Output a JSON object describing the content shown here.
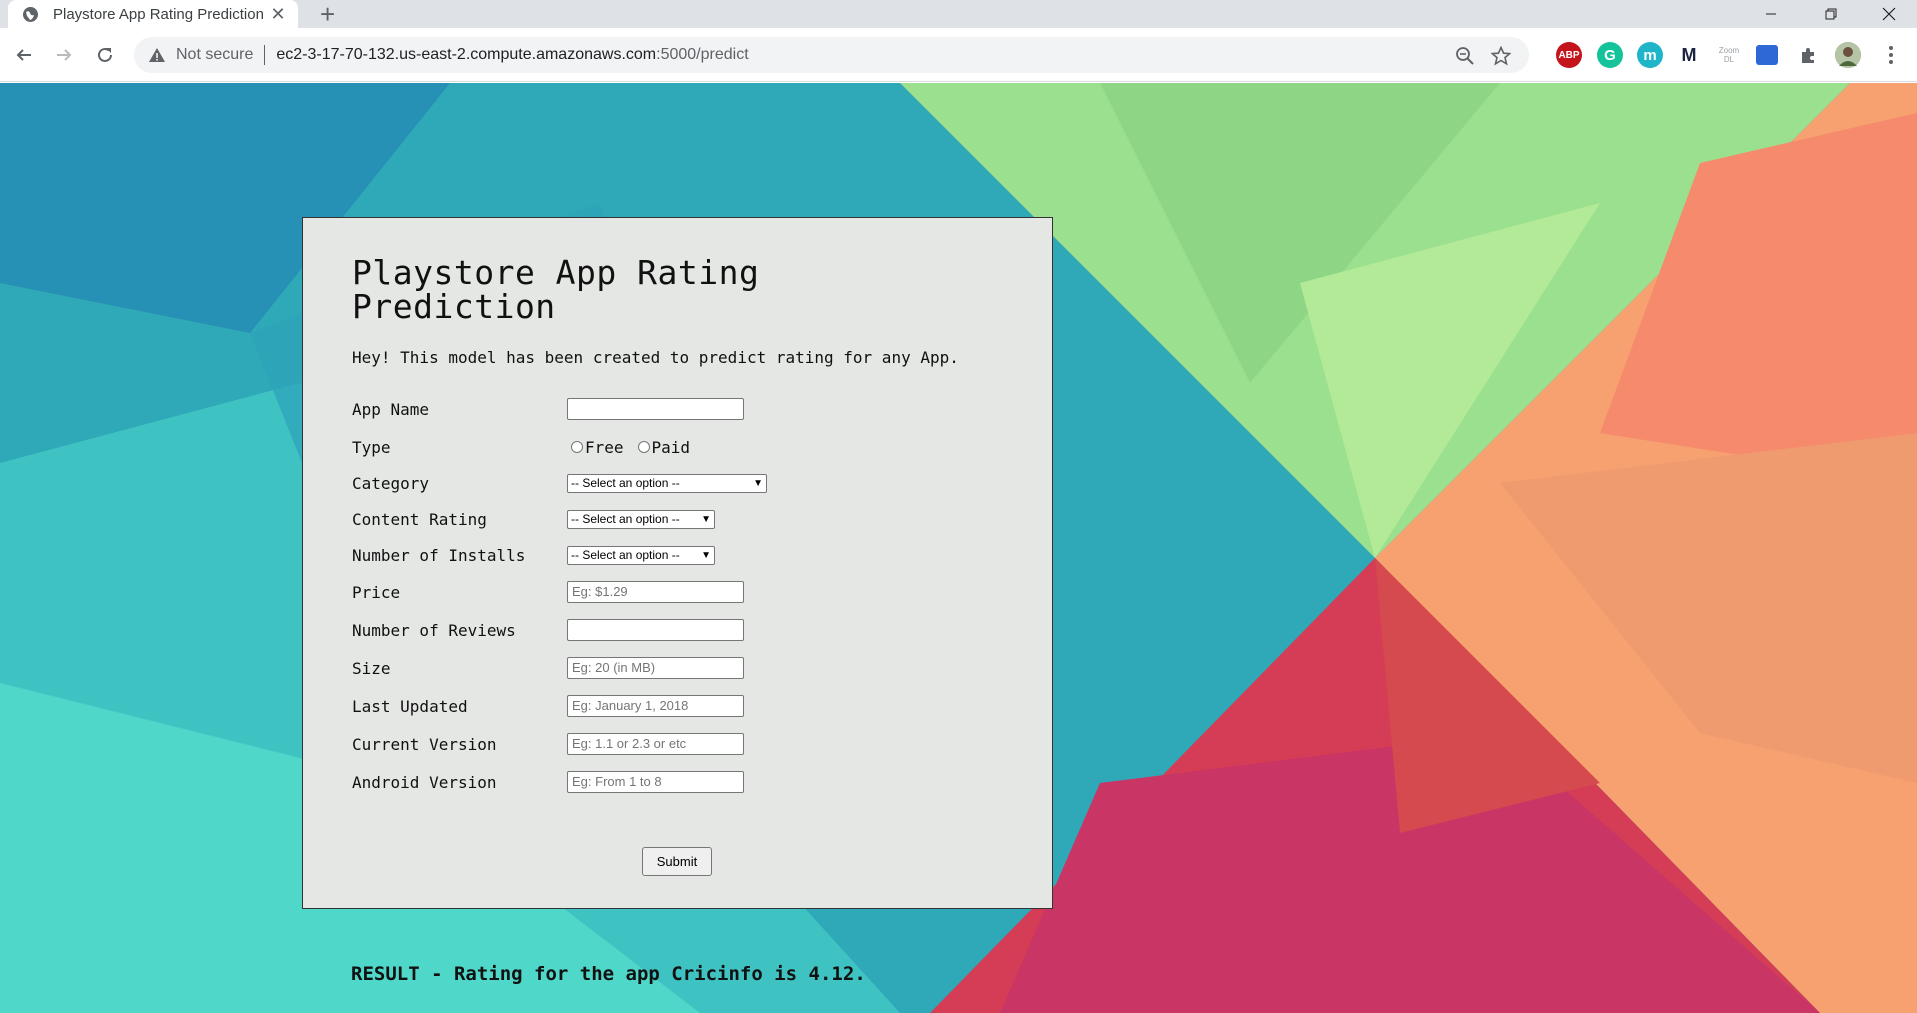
{
  "browser": {
    "tab_title": "Playstore App Rating Prediction",
    "security_label": "Not secure",
    "url_host": "ec2-3-17-70-132.us-east-2.compute.amazonaws.com",
    "url_path": ":5000/predict",
    "extensions": [
      "ABP",
      "G",
      "m",
      "M",
      "Zoom DL"
    ]
  },
  "form": {
    "title": "Playstore App Rating Prediction",
    "subtitle": "Hey! This model has been created to predict rating for any App.",
    "labels": {
      "app_name": "App Name",
      "type": "Type",
      "category": "Category",
      "content_rating": "Content Rating",
      "installs": "Number of Installs",
      "price": "Price",
      "reviews": "Number of Reviews",
      "size": "Size",
      "last_updated": "Last Updated",
      "current_version": "Current Version",
      "android_version": "Android Version"
    },
    "type_options": [
      "Free",
      "Paid"
    ],
    "select_placeholder": "-- Select an option --",
    "placeholders": {
      "price": "Eg: $1.29",
      "size": "Eg: 20 (in MB)",
      "last_updated": "Eg: January 1, 2018",
      "current_version": "Eg: 1.1 or 2.3 or etc",
      "android_version": "Eg: From 1 to 8"
    },
    "submit_label": "Submit"
  },
  "result": "RESULT - Rating for the app Cricinfo is 4.12.",
  "colors": {
    "teal": "#2a9fb5",
    "green": "#9be08f",
    "orange": "#f7a070",
    "crimson": "#d43d55"
  }
}
